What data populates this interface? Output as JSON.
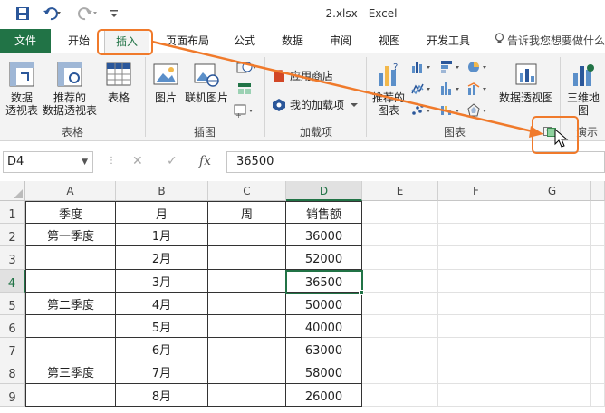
{
  "window": {
    "title": "2.xlsx - Excel"
  },
  "quick_access": {
    "save_icon": "save-icon",
    "undo_icon": "undo-icon",
    "redo_icon": "redo-icon",
    "customize_icon": "customize-icon"
  },
  "tabs": [
    {
      "label": "文件"
    },
    {
      "label": "开始"
    },
    {
      "label": "插入"
    },
    {
      "label": "页面布局"
    },
    {
      "label": "公式"
    },
    {
      "label": "数据"
    },
    {
      "label": "审阅"
    },
    {
      "label": "视图"
    },
    {
      "label": "开发工具"
    }
  ],
  "tell_me": "告诉我您想要做什么",
  "ribbon": {
    "tables": {
      "pivot": "数据\n透视表",
      "recommended_pivot": "推荐的\n数据透视表",
      "table": "表格",
      "group": "表格"
    },
    "illustrations": {
      "picture": "图片",
      "online_picture": "联机图片",
      "group": "插图"
    },
    "addins": {
      "store": "应用商店",
      "my_addins": "我的加载项",
      "group": "加载项"
    },
    "charts": {
      "recommended": "推荐的\n图表",
      "pivot_chart": "数据透视图",
      "group": "图表"
    },
    "tours": {
      "map3d": "三维地\n图",
      "group": "演示"
    }
  },
  "formula_bar": {
    "name_box": "D4",
    "value": "36500",
    "fx": "fx"
  },
  "columns": [
    "A",
    "B",
    "C",
    "D",
    "E",
    "F",
    "G"
  ],
  "rows": [
    "1",
    "2",
    "3",
    "4",
    "5",
    "6",
    "7",
    "8",
    "9"
  ],
  "cells": [
    [
      "季度",
      "月",
      "周",
      "销售额"
    ],
    [
      "第一季度",
      "1月",
      "",
      "36000"
    ],
    [
      "",
      "2月",
      "",
      "52000"
    ],
    [
      "",
      "3月",
      "",
      "36500"
    ],
    [
      "第二季度",
      "4月",
      "",
      "50000"
    ],
    [
      "",
      "5月",
      "",
      "40000"
    ],
    [
      "",
      "6月",
      "",
      "63000"
    ],
    [
      "第三季度",
      "7月",
      "",
      "58000"
    ],
    [
      "",
      "8月",
      "",
      "26000"
    ]
  ],
  "colors": {
    "excel_green": "#217346",
    "annotation_orange": "#f07a2b"
  }
}
